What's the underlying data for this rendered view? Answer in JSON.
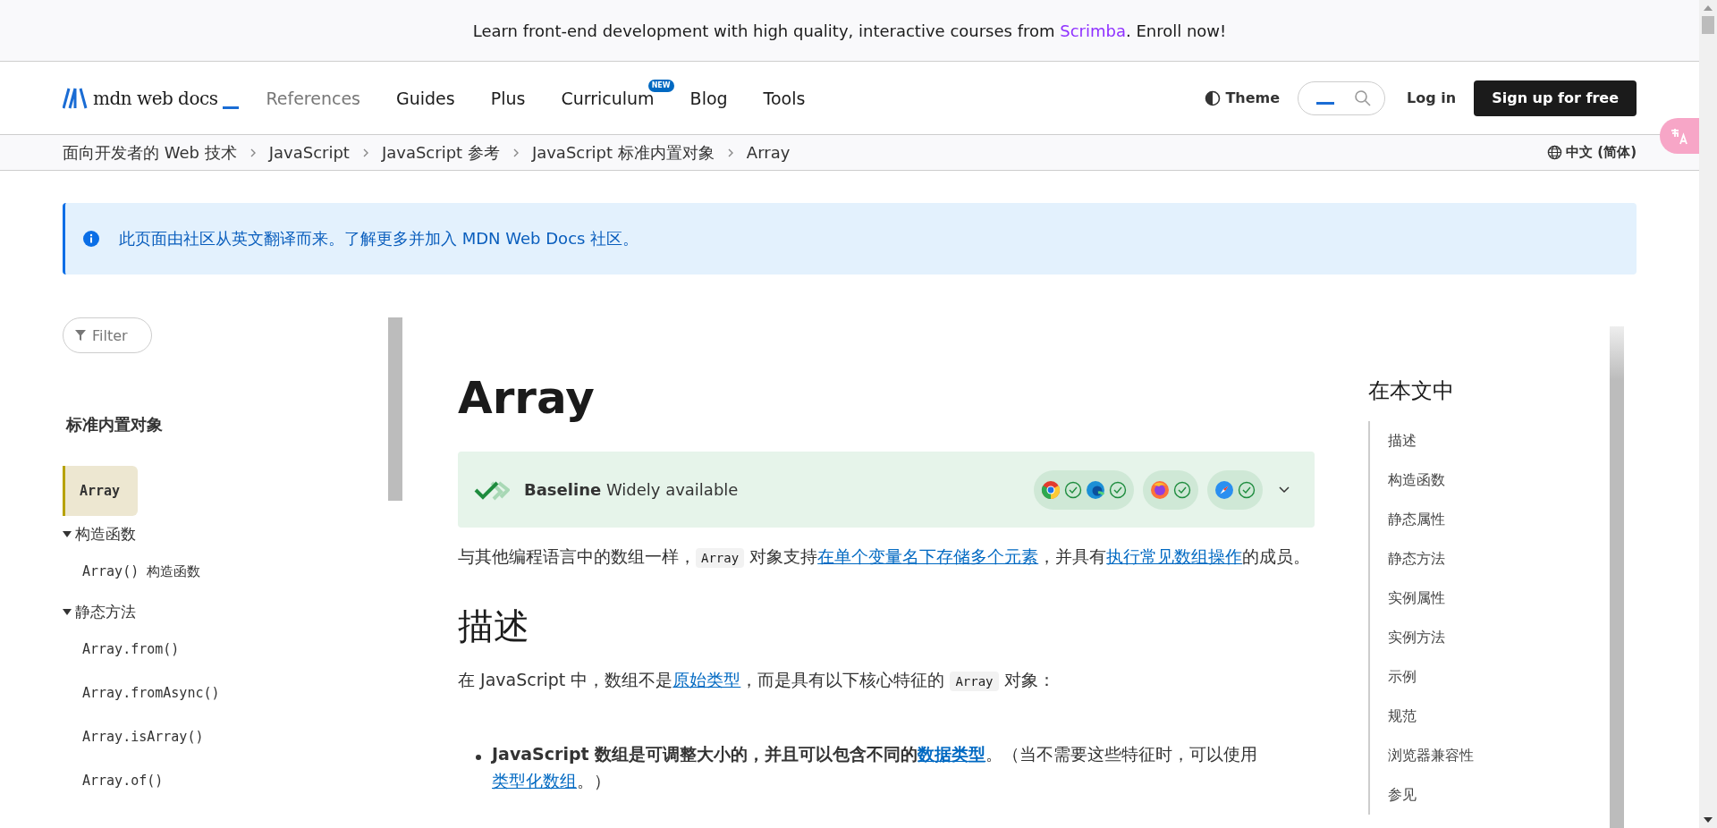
{
  "banner": {
    "before": "Learn front-end development with high quality, interactive courses from ",
    "link": "Scrimba",
    "after": ". Enroll now!"
  },
  "header": {
    "logo": "mdn web docs",
    "nav": [
      {
        "label": "References",
        "selected": true
      },
      {
        "label": "Guides",
        "selected": false
      },
      {
        "label": "Plus",
        "selected": false
      },
      {
        "label": "Curriculum",
        "selected": false,
        "badge": "NEW"
      },
      {
        "label": "Blog",
        "selected": false
      },
      {
        "label": "Tools",
        "selected": false
      }
    ],
    "theme": "Theme",
    "login": "Log in",
    "signup": "Sign up for free"
  },
  "breadcrumbs": [
    "面向开发者的 Web 技术",
    "JavaScript",
    "JavaScript 参考",
    "JavaScript 标准内置对象",
    "Array"
  ],
  "language": "中文 (简体)",
  "notice": "此页面由社区从英文翻译而来。了解更多并加入 MDN Web Docs 社区。",
  "sidebar": {
    "filter_placeholder": "Filter",
    "heading": "标准内置对象",
    "items": [
      {
        "label": "Array",
        "selected": true
      },
      {
        "label": "构造函数",
        "expanded": true,
        "children": [
          {
            "label": "Array() 构造函数",
            "selected": false
          }
        ]
      },
      {
        "label": "静态方法",
        "expanded": true,
        "children": [
          {
            "label": "Array.from()",
            "selected": false
          },
          {
            "label": "Array.fromAsync()",
            "selected": false
          },
          {
            "label": "Array.isArray()",
            "selected": false
          },
          {
            "label": "Array.of()",
            "selected": false
          }
        ]
      }
    ]
  },
  "article": {
    "title": "Array",
    "baseline": {
      "label": "Baseline",
      "status": "Widely available",
      "browsers": [
        {
          "kind": "chromium"
        },
        {
          "kind": "firefox"
        },
        {
          "kind": "safari"
        }
      ]
    },
    "intro": [
      {
        "kind": "text",
        "text": "与其他编程语言中的数组一样，"
      },
      {
        "kind": "code",
        "text": "Array"
      },
      {
        "kind": "text",
        "text": " 对象支持"
      },
      {
        "kind": "link",
        "text": "在单个变量名下存储多个元素"
      },
      {
        "kind": "text",
        "text": "，并具有"
      },
      {
        "kind": "link",
        "text": "执行常见数组操作"
      },
      {
        "kind": "text",
        "text": "的成员。"
      }
    ],
    "section_title": "描述",
    "description": [
      {
        "kind": "text",
        "text": "在 JavaScript 中，数组不是"
      },
      {
        "kind": "link",
        "text": "原始类型"
      },
      {
        "kind": "text",
        "text": "，而是具有以下核心特征的 "
      },
      {
        "kind": "code",
        "text": "Array"
      },
      {
        "kind": "text",
        "text": " 对象："
      }
    ],
    "bullets": [
      [
        {
          "kind": "bold",
          "text": "JavaScript 数组是可调整大小的，并且可以包含不同的"
        },
        {
          "kind": "boldlink",
          "text": "数据类型"
        },
        {
          "kind": "text",
          "text": "。（当不需要这些特征时，可以使用"
        },
        {
          "kind": "link",
          "text": "类型化数组"
        },
        {
          "kind": "text",
          "text": "。）"
        }
      ]
    ]
  },
  "toc": {
    "heading": "在本文中",
    "items": [
      "描述",
      "构造函数",
      "静态属性",
      "静态方法",
      "实例属性",
      "实例方法",
      "示例",
      "规范",
      "浏览器兼容性",
      "参见"
    ]
  }
}
